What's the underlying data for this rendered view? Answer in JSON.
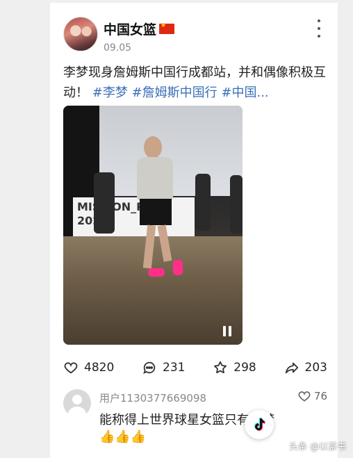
{
  "post": {
    "author": "中国女篮",
    "date": "09.05",
    "text_plain": "李梦现身詹姆斯中国行成都站，并和偶像积极互动！",
    "hashtags": [
      "#李梦",
      "#詹姆斯中国行",
      "#中国..."
    ]
  },
  "video": {
    "banner_text_line1": "MISSION_P",
    "banner_text_line2": "202"
  },
  "actions": {
    "likes": "4820",
    "comments": "231",
    "favorites": "298",
    "shares": "203"
  },
  "comment": {
    "user": "用户1130377669098",
    "likes": "76",
    "text": "能称得上世界球星女篮只有李梦",
    "emoji": "👍👍👍"
  },
  "watermark": "头条 @以茶书",
  "icons": {
    "more": "more-vertical-icon",
    "like": "heart-icon",
    "comment": "comment-bubble-icon",
    "favorite": "star-icon",
    "share": "share-arrow-icon",
    "pause": "pause-icon",
    "badge": "tiktok-logo-icon"
  },
  "colors": {
    "hashtag": "#3b6fb6",
    "flag": "#de2910",
    "shoe": "#ff2f8a"
  }
}
